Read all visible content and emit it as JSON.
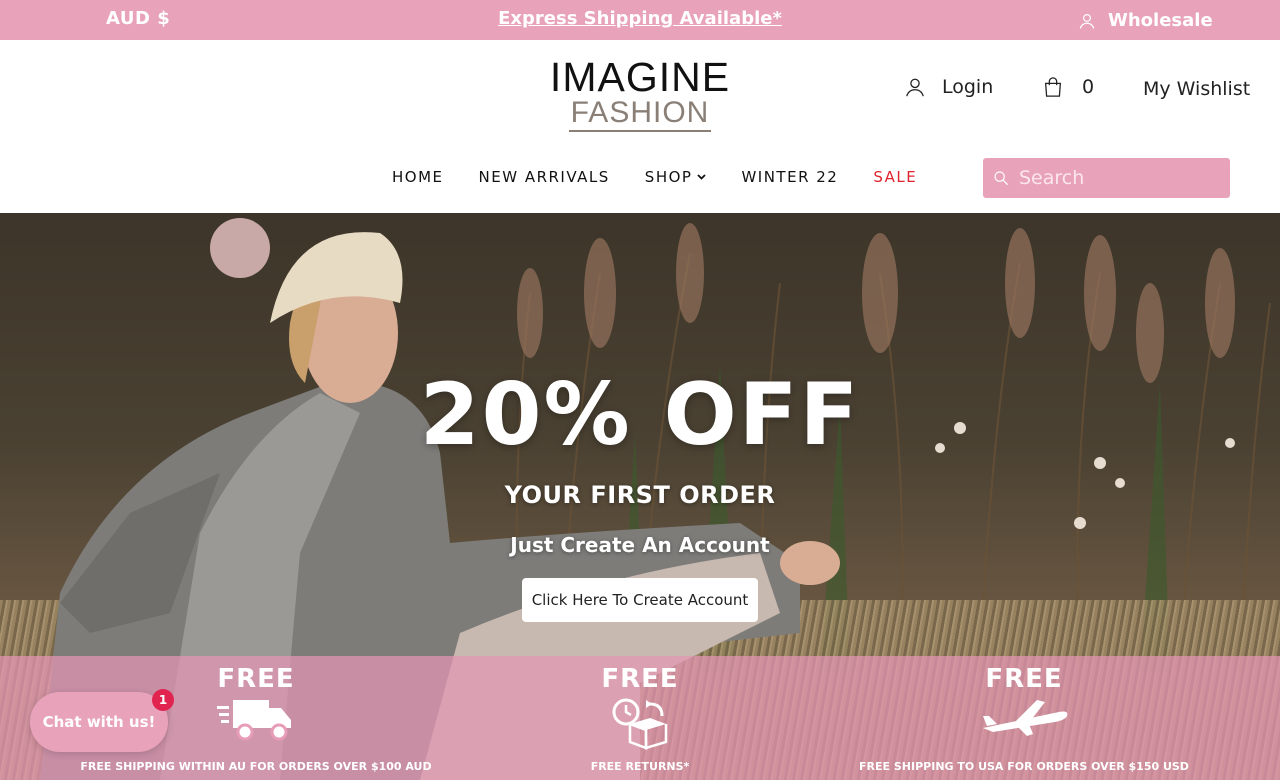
{
  "topbar": {
    "currency": "AUD $",
    "announcement": "Express Shipping Available*",
    "wholesale": "Wholesale"
  },
  "logo": {
    "line1": "IMAGINE",
    "line2": "FASHION"
  },
  "header": {
    "login": "Login",
    "cart_count": "0",
    "wishlist": "My Wishlist"
  },
  "nav": {
    "items": [
      {
        "label": "HOME"
      },
      {
        "label": "NEW ARRIVALS"
      },
      {
        "label": "SHOP"
      },
      {
        "label": "WINTER 22"
      },
      {
        "label": "SALE"
      }
    ]
  },
  "search": {
    "placeholder": "Search"
  },
  "hero": {
    "headline": "20% OFF",
    "subheadline": "YOUR FIRST ORDER",
    "tagline": "Just Create An Account",
    "cta": "Click Here To Create Account"
  },
  "features": [
    {
      "title": "FREE",
      "icon": "delivery-truck-icon",
      "caption": "FREE SHIPPING WITHIN AU FOR ORDERS OVER $100 AUD"
    },
    {
      "title": "FREE",
      "icon": "returns-box-icon",
      "caption": "FREE RETURNS*"
    },
    {
      "title": "FREE",
      "icon": "airplane-icon",
      "caption": "FREE SHIPPING TO USA FOR ORDERS OVER $150 USD"
    }
  ],
  "chat": {
    "label": "Chat with us!",
    "badge": "1"
  },
  "colors": {
    "brand_pink": "#e8a3bb",
    "sale_red": "#e0242f"
  }
}
